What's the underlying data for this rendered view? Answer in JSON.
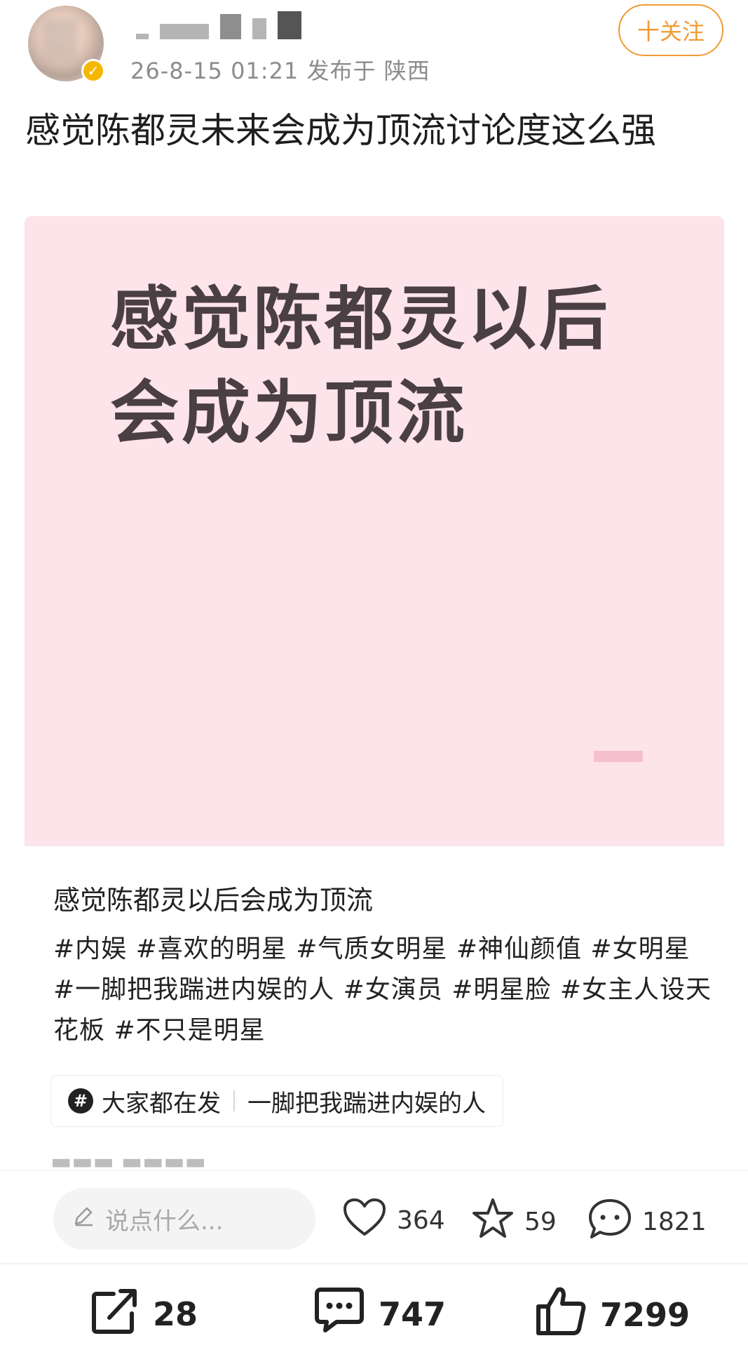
{
  "post": {
    "meta": "26-8-15 01:21  发布于 陕西",
    "follow_label": "十关注",
    "title": "感觉陈都灵未来会成为顶流讨论度这么强",
    "image_text_line1": "感觉陈都灵以后",
    "image_text_line2": "会成为顶流",
    "description": "感觉陈都灵以后会成为顶流",
    "tags": "#内娱 #喜欢的明星 #气质女明星 #神仙颜值 #女明星 #一脚把我踹进内娱的人 #女演员 #明星脸 #女主人设天花板 #不只是明星",
    "trend_chip": {
      "label": "大家都在发",
      "topic": "一脚把我踹进内娱的人"
    }
  },
  "comment_bar": {
    "placeholder": "说点什么...",
    "likes": "364",
    "favorites": "59",
    "comments": "1821"
  },
  "bottom_bar": {
    "shares": "28",
    "comments": "747",
    "likes": "7299"
  },
  "colors": {
    "accent": "#f19a36",
    "image_bg": "#fde3ea",
    "verified": "#f5b800"
  },
  "icons": [
    "check-icon",
    "hash-icon",
    "pencil-icon",
    "heart-icon",
    "star-icon",
    "chat-bubble-icon",
    "share-icon",
    "comment-icon",
    "thumbs-up-icon"
  ]
}
